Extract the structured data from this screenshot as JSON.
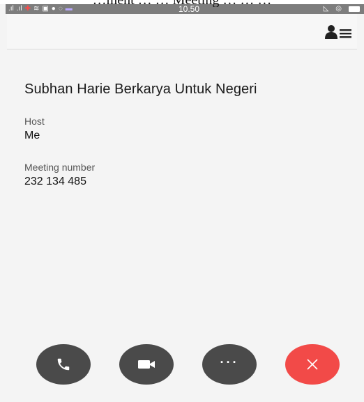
{
  "caption_overlay": "…ment … … Meeting … … …",
  "status_bar": {
    "time": "10.50",
    "icons": [
      "signal-icon",
      "signal-icon",
      "notification-icon",
      "wifi-icon",
      "gallery-icon",
      "browser-icon",
      "whatsapp-icon",
      "message-icon",
      "alarm-icon",
      "eye-icon",
      "battery-icon"
    ]
  },
  "app_bar": {
    "participants_icon": "participants-list-icon"
  },
  "meeting": {
    "title": "Subhan Harie Berkarya Untuk Negeri",
    "host_label": "Host",
    "host_value": "Me",
    "number_label": "Meeting number",
    "number_value": "232 134 485"
  },
  "controls": {
    "audio_icon": "phone-icon",
    "video_icon": "video-camera-icon",
    "more_label": "···",
    "end_icon": "close-icon"
  },
  "colors": {
    "background": "#f4f4f4",
    "button_dark": "#4a4a4a",
    "button_end": "#f24a48",
    "status_bar": "#7d7d7d"
  }
}
